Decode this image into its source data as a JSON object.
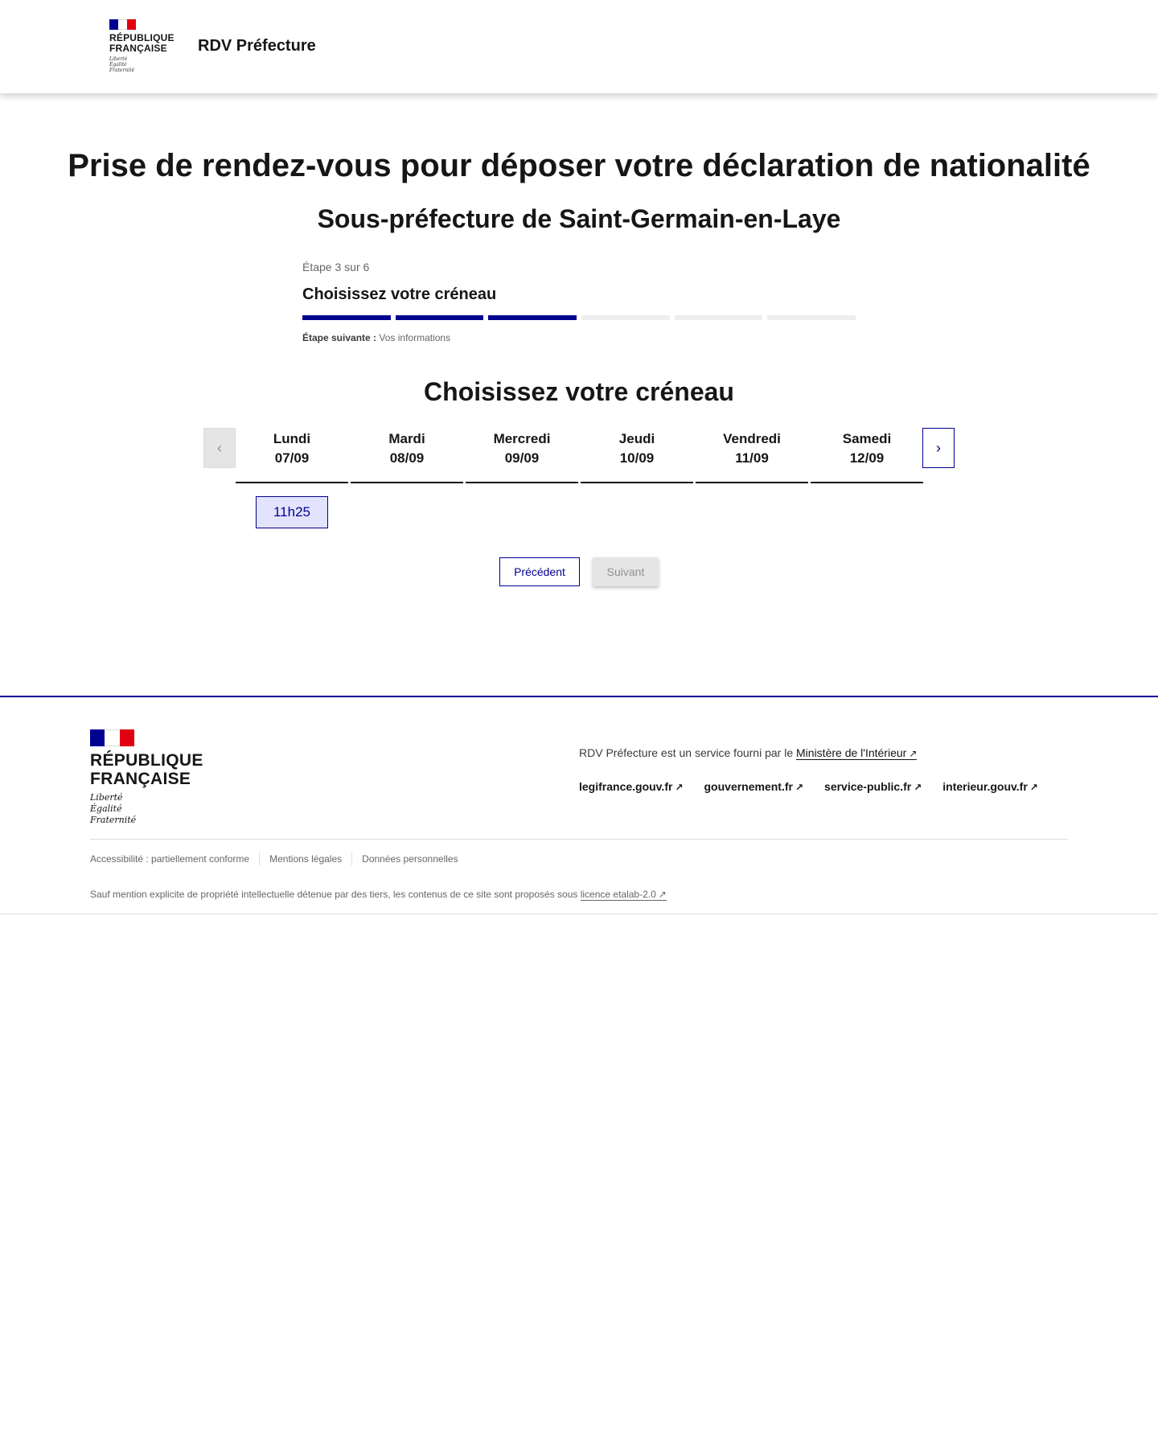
{
  "header": {
    "republique_line1": "RÉPUBLIQUE",
    "republique_line2": "FRANÇAISE",
    "devise": [
      "Liberté",
      "Égalité",
      "Fraternité"
    ],
    "service_title": "RDV Préfecture"
  },
  "main": {
    "title": "Prise de rendez-vous pour déposer votre déclaration de nationalité",
    "subtitle": "Sous-préfecture de Saint-Germain-en-Laye"
  },
  "stepper": {
    "state": "Étape 3 sur 6",
    "title": "Choisissez votre créneau",
    "current_step": 3,
    "total_steps": 6,
    "next_label": "Étape suivante :",
    "next_value": "Vos informations"
  },
  "slots": {
    "title": "Choisissez votre créneau",
    "days": [
      {
        "name": "Lundi",
        "date": "07/09"
      },
      {
        "name": "Mardi",
        "date": "08/09"
      },
      {
        "name": "Mercredi",
        "date": "09/09"
      },
      {
        "name": "Jeudi",
        "date": "10/09"
      },
      {
        "name": "Vendredi",
        "date": "11/09"
      },
      {
        "name": "Samedi",
        "date": "12/09"
      }
    ],
    "available": [
      {
        "day": "Lundi",
        "time": "11h25"
      }
    ],
    "prev_icon": "chevron-left-icon",
    "next_icon": "chevron-right-icon"
  },
  "actions": {
    "prev_label": "Précédent",
    "next_label": "Suivant"
  },
  "footer": {
    "republique_line1": "RÉPUBLIQUE",
    "republique_line2": "FRANÇAISE",
    "devise": [
      "Liberté",
      "Égalité",
      "Fraternité"
    ],
    "desc_prefix": "RDV Préfecture est un service fourni par le",
    "desc_link": "Ministère de l'Intérieur",
    "links": [
      "legifrance.gouv.fr",
      "gouvernement.fr",
      "service-public.fr",
      "interieur.gouv.fr"
    ],
    "bottom_links": [
      "Accessibilité : partiellement conforme",
      "Mentions légales",
      "Données personnelles"
    ],
    "license_prefix": "Sauf mention explicite de propriété intellectuelle détenue par des tiers, les contenus de ce site sont proposés sous",
    "license_link": "licence etalab-2.0"
  },
  "colors": {
    "primary": "#000091",
    "flag_red": "#e1000f",
    "slot_bg": "#e3e3fd",
    "disabled_bg": "#e5e5e5"
  }
}
